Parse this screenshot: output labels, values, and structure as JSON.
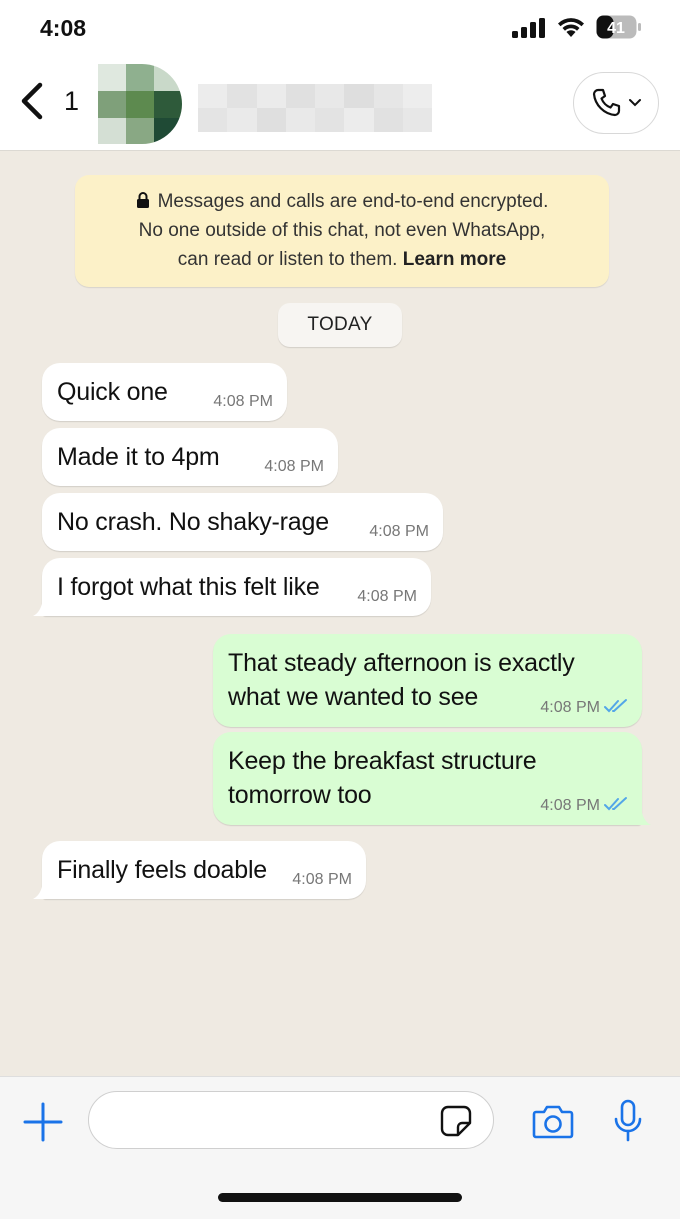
{
  "status": {
    "time": "4:08",
    "battery": "41"
  },
  "header": {
    "unread_count": "1"
  },
  "encryption": {
    "line1": "Messages and calls are end-to-end encrypted.",
    "line2": "No one outside of this chat, not even WhatsApp,",
    "line3": "can read or listen to them.",
    "learn_more": "Learn more"
  },
  "date_label": "TODAY",
  "messages": [
    {
      "direction": "in",
      "text": "Quick one",
      "time": "4:08 PM"
    },
    {
      "direction": "in",
      "text": "Made it to 4pm",
      "time": "4:08 PM"
    },
    {
      "direction": "in",
      "text": "No crash. No shaky-rage",
      "time": "4:08 PM"
    },
    {
      "direction": "in",
      "text": "I forgot what this felt like",
      "time": "4:08 PM"
    },
    {
      "direction": "out",
      "line1": "That steady afternoon is exactly",
      "line2": "what we wanted to see",
      "time": "4:08 PM",
      "status": "read"
    },
    {
      "direction": "out",
      "line1": "Keep the breakfast structure",
      "line2": "tomorrow too",
      "time": "4:08 PM",
      "status": "read"
    },
    {
      "direction": "in",
      "text": "Finally feels doable",
      "time": "4:08 PM"
    }
  ],
  "composer": {
    "placeholder": ""
  },
  "colors": {
    "accent": "#1a73e8",
    "outgoing_bubble": "#d9fdd3",
    "incoming_bubble": "#ffffff",
    "notice": "#fcf1c8",
    "read_ticks": "#53a6e8"
  }
}
